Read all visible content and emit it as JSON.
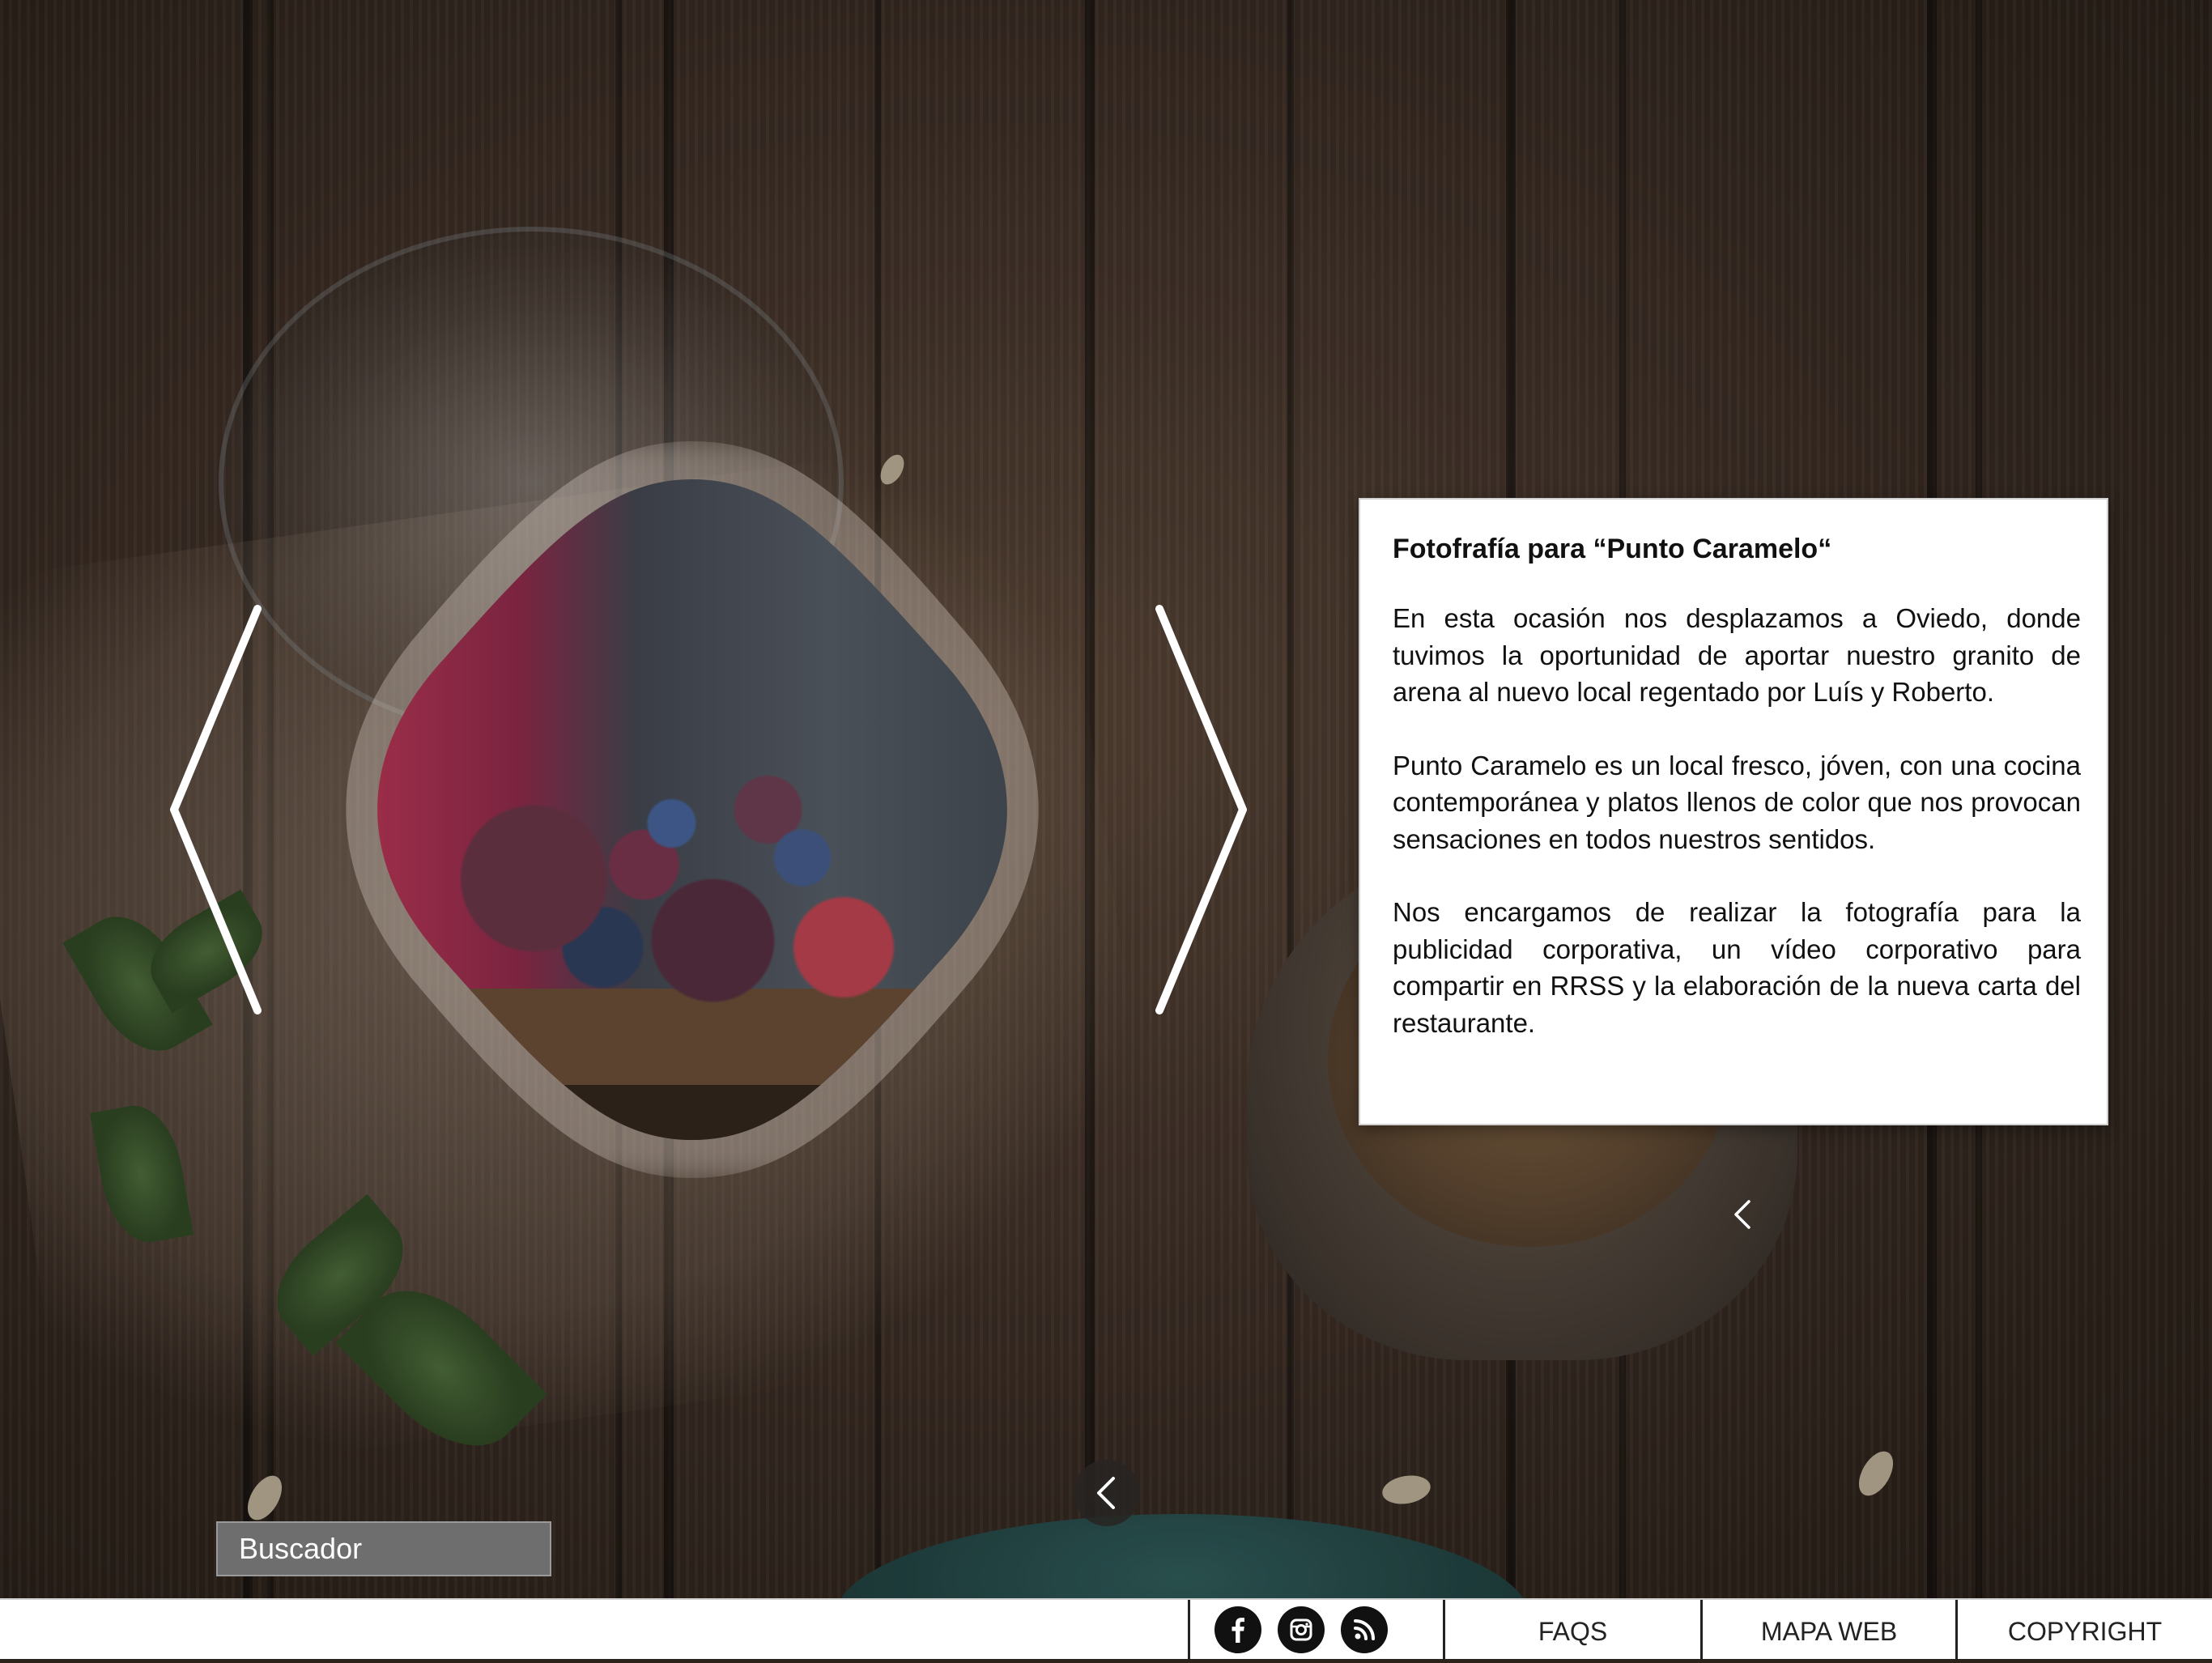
{
  "search": {
    "placeholder": "Buscador"
  },
  "slider": {
    "prev_label": "Anterior",
    "next_label": "Siguiente"
  },
  "info": {
    "title": "Fotofrafía para “Punto Caramelo“",
    "paragraphs": [
      "En esta ocasión nos desplazamos a Oviedo, donde tuvimos la oportunidad de aportar nuestro granito de arena al nuevo local regentado por Luís y Roberto.",
      "Punto Caramelo es un local fresco, jóven, con una cocina contemporánea y platos llenos de color que nos provocan sensaciones en todos nuestros sentidos.",
      "Nos encargamos de realizar la fotografía para la publicidad corporativa, un vídeo corporativo para compartir en RRSS y la elaboración de la nueva carta del restaurante."
    ]
  },
  "footer": {
    "social": [
      {
        "icon": "facebook-icon"
      },
      {
        "icon": "instagram-icon"
      },
      {
        "icon": "rss-icon"
      }
    ],
    "links": [
      "FAQS",
      "MAPA WEB",
      "COPYRIGHT"
    ]
  },
  "colors": {
    "card_bg": "#ffffff",
    "footer_bg": "#ffffff",
    "search_bg": "#6e6e6e",
    "arrow": "#ffffff"
  }
}
